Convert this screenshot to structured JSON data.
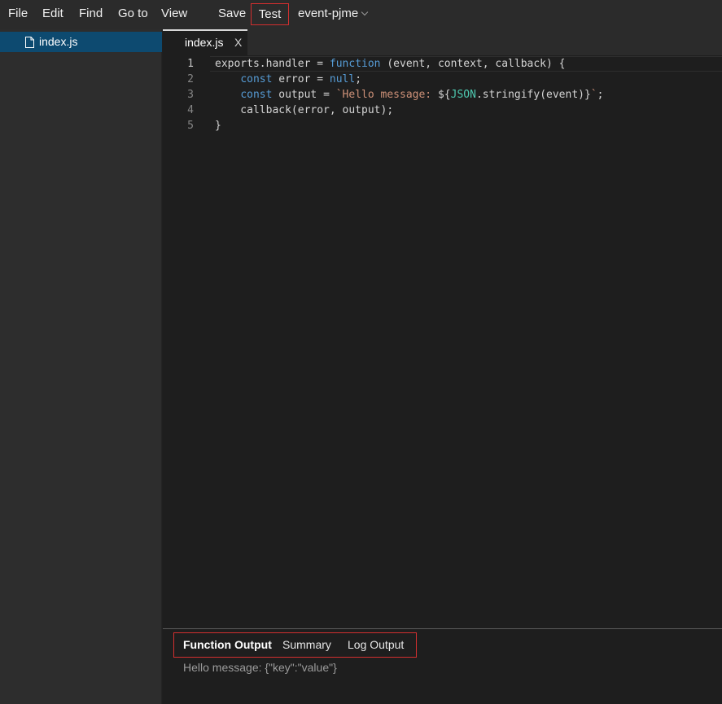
{
  "menubar": {
    "file": "File",
    "edit": "Edit",
    "find": "Find",
    "goto": "Go to",
    "view": "View",
    "save": "Save",
    "test": "Test",
    "environment": "event-pjme"
  },
  "sidebar": {
    "files": [
      {
        "name": "index.js",
        "selected": true
      }
    ]
  },
  "editor": {
    "tab": {
      "label": "index.js",
      "close": "X"
    },
    "line_numbers": [
      "1",
      "2",
      "3",
      "4",
      "5"
    ],
    "code": {
      "l1_a": "exports.handler = ",
      "l1_kw": "function",
      "l1_b": " (event, context, callback) {",
      "l2_indent": "    ",
      "l2_kw": "const",
      "l2_b": " error = ",
      "l2_null": "null",
      "l2_c": ";",
      "l3_indent": "    ",
      "l3_kw": "const",
      "l3_b": " output = ",
      "l3_str": "`Hello message: ",
      "l3_interp_open": "${",
      "l3_json": "JSON",
      "l3_c": ".stringify(event)",
      "l3_interp_close": "}",
      "l3_str_end": "`",
      "l3_d": ";",
      "l4": "    callback(error, output);",
      "l5": "}"
    }
  },
  "bottom_panel": {
    "tabs": {
      "function_output": "Function Output",
      "summary": "Summary",
      "log_output": "Log Output"
    },
    "output": "Hello message: {\"key\":\"value\"}"
  },
  "colors": {
    "accent_border": "#d32f2f",
    "selected_file": "#0d4a70",
    "keyword": "#569cd6",
    "string": "#ce9178",
    "type": "#4ec9b0"
  }
}
